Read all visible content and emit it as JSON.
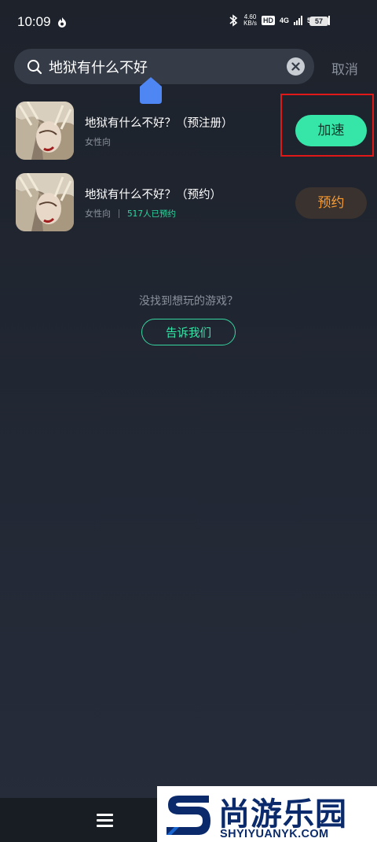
{
  "status_bar": {
    "time": "10:09",
    "speed_value": "4.60",
    "speed_unit": "KB/s",
    "hd_label": "HD",
    "net1": "4G",
    "net2": "5G",
    "battery": "57"
  },
  "search": {
    "query": "地狱有什么不好",
    "cancel_label": "取消"
  },
  "results": [
    {
      "title": "地狱有什么不好？（预注册）",
      "tag": "女性向",
      "reserve_count": "",
      "button_label": "加速"
    },
    {
      "title": "地狱有什么不好？（预约）",
      "tag": "女性向",
      "reserve_count": "517人已预约",
      "button_label": "预约"
    }
  ],
  "empty_state": {
    "hint": "没找到想玩的游戏？",
    "tell_us_label": "告诉我们"
  },
  "watermark": {
    "name": "尚游乐园",
    "site": "SHYIYUANYK.COM"
  },
  "colors": {
    "accent_green": "#36e6a9",
    "reserve_orange": "#f59a33",
    "highlight_red": "#e01818",
    "background": "#222834"
  }
}
